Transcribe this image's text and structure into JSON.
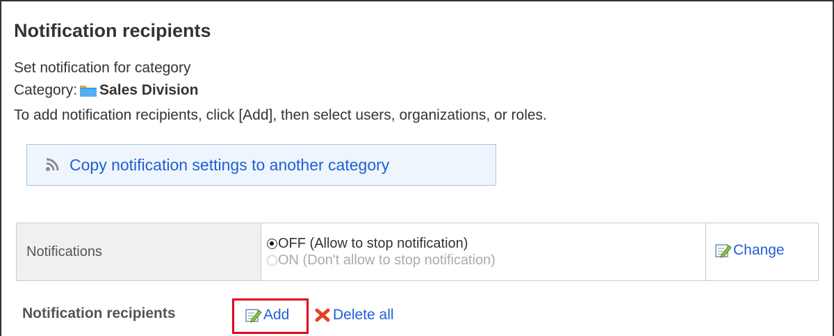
{
  "page": {
    "title": "Notification recipients",
    "set_text": "Set notification for category",
    "category_label": "Category:",
    "category_name": "Sales Division",
    "help_text": "To add notification recipients, click [Add], then select users, organizations, or roles."
  },
  "copy_button": {
    "label": "Copy notification settings to another category"
  },
  "notifications": {
    "header": "Notifications",
    "options": [
      {
        "label": "OFF (Allow to stop notification)",
        "selected": true
      },
      {
        "label": "ON (Don't allow to stop notification)",
        "selected": false
      }
    ],
    "change_label": "Change"
  },
  "recipients": {
    "label": "Notification recipients",
    "add_label": "Add",
    "delete_all_label": "Delete all"
  },
  "colors": {
    "link": "#1f5fd6",
    "highlight": "#e3001b",
    "folder": "#3d9be0"
  },
  "icons": [
    "folder-icon",
    "rss-icon",
    "edit-icon",
    "delete-x-icon"
  ]
}
